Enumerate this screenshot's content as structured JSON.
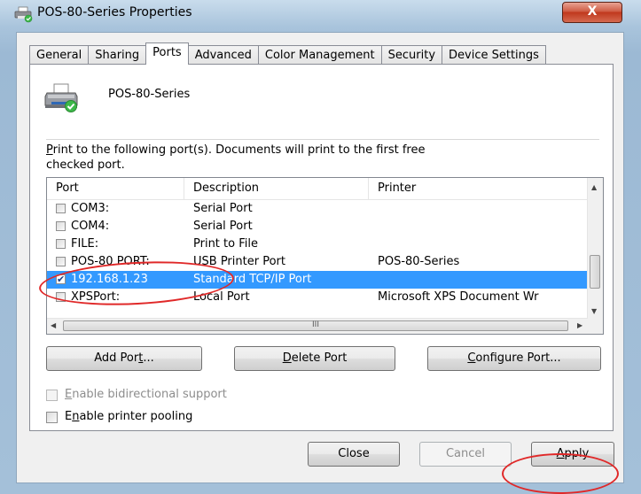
{
  "window": {
    "title": "POS-80-Series Properties",
    "close_glyph": "X"
  },
  "tabs": [
    {
      "label": "General",
      "active": false
    },
    {
      "label": "Sharing",
      "active": false
    },
    {
      "label": "Ports",
      "active": true
    },
    {
      "label": "Advanced",
      "active": false
    },
    {
      "label": "Color Management",
      "active": false
    },
    {
      "label": "Security",
      "active": false
    },
    {
      "label": "Device Settings",
      "active": false
    }
  ],
  "printer": {
    "name": "POS-80-Series",
    "icon": "printer-icon"
  },
  "instruction": {
    "line1_mnemonic": "P",
    "line1_rest": "rint to the following port(s). Documents will print to the first free",
    "line2": "checked port."
  },
  "port_list": {
    "columns": [
      "Port",
      "Description",
      "Printer"
    ],
    "rows": [
      {
        "port": "COM3:",
        "description": "Serial Port",
        "printer": "",
        "checked": false,
        "selected": false
      },
      {
        "port": "COM4:",
        "description": "Serial Port",
        "printer": "",
        "checked": false,
        "selected": false
      },
      {
        "port": "FILE:",
        "description": "Print to File",
        "printer": "",
        "checked": false,
        "selected": false
      },
      {
        "port": "POS-80 PORT:",
        "description": "USB Printer Port",
        "printer": "POS-80-Series",
        "checked": false,
        "selected": false
      },
      {
        "port": "192.168.1.23",
        "description": "Standard TCP/IP Port",
        "printer": "",
        "checked": true,
        "selected": true
      },
      {
        "port": "XPSPort:",
        "description": "Local Port",
        "printer": "Microsoft XPS Document Wr",
        "checked": false,
        "selected": false
      }
    ],
    "hscroll_grip": "III"
  },
  "port_buttons": {
    "add_pre": "Add Por",
    "add_key": "t",
    "add_post": "...",
    "delete_key": "D",
    "delete_rest": "elete Port",
    "configure_key": "C",
    "configure_rest": "onfigure Port..."
  },
  "options": {
    "bidirectional": {
      "key": "E",
      "rest": "nable bidirectional support",
      "enabled": false,
      "checked": false
    },
    "pooling": {
      "pre": "E",
      "key": "n",
      "rest": "able printer pooling",
      "enabled": true,
      "checked": false
    }
  },
  "dialog_buttons": {
    "close": "Close",
    "cancel": "Cancel",
    "apply_key": "A",
    "apply_rest": "pply"
  },
  "colors": {
    "selection": "#3399ff",
    "annotation": "#e02828",
    "close_button": "#c0381d"
  }
}
